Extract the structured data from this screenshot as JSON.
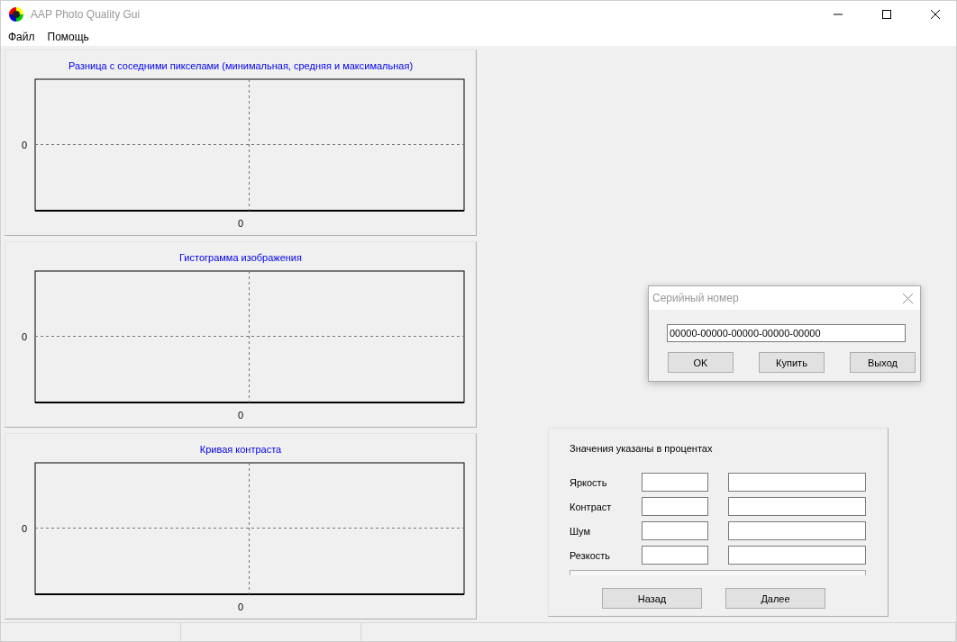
{
  "window": {
    "title": "AAP Photo Quality Gui"
  },
  "menu": [
    "Файл",
    "Помощь"
  ],
  "charts": [
    {
      "title": "Разница с соседними пикселами (минимальная, средняя и максимальная)",
      "y_tick": "0",
      "x_tick": "0"
    },
    {
      "title": "Гистограмма изображения",
      "y_tick": "0",
      "x_tick": "0"
    },
    {
      "title": "Кривая контраста",
      "y_tick": "0",
      "x_tick": "0"
    }
  ],
  "dialog": {
    "title": "Серийный номер",
    "serial": "00000-00000-00000-00000-00000",
    "buttons": [
      "OK",
      "Купить",
      "Выход"
    ]
  },
  "values_panel": {
    "caption": "Значения указаны в процентах",
    "rows": [
      {
        "label": "Яркость"
      },
      {
        "label": "Контраст"
      },
      {
        "label": "Шум"
      },
      {
        "label": "Резкость"
      }
    ],
    "progress": {
      "level": 0
    },
    "buttons": [
      "Назад",
      "Далее"
    ]
  }
}
